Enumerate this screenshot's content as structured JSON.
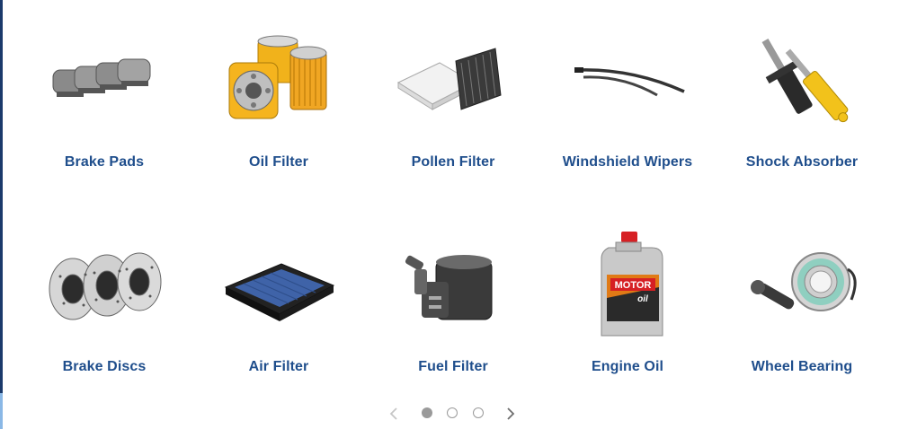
{
  "products": [
    {
      "label": "Brake Pads",
      "icon": "brake-pads-icon"
    },
    {
      "label": "Oil Filter",
      "icon": "oil-filter-icon"
    },
    {
      "label": "Pollen Filter",
      "icon": "pollen-filter-icon"
    },
    {
      "label": "Windshield Wipers",
      "icon": "windshield-wipers-icon"
    },
    {
      "label": "Shock Absorber",
      "icon": "shock-absorber-icon"
    },
    {
      "label": "Brake Discs",
      "icon": "brake-discs-icon"
    },
    {
      "label": "Air Filter",
      "icon": "air-filter-icon"
    },
    {
      "label": "Fuel Filter",
      "icon": "fuel-filter-icon"
    },
    {
      "label": "Engine Oil",
      "icon": "engine-oil-icon"
    },
    {
      "label": "Wheel Bearing",
      "icon": "wheel-bearing-icon"
    }
  ],
  "engine_oil_can": {
    "brand": "MOTOR",
    "sub": "oil"
  },
  "pager": {
    "pages": 3,
    "current": 1,
    "prev_icon": "chevron-left-icon",
    "next_icon": "chevron-right-icon"
  },
  "colors": {
    "label": "#1f4e8c",
    "rail": "#1b3a6b",
    "dot": "#9a9a9a"
  }
}
